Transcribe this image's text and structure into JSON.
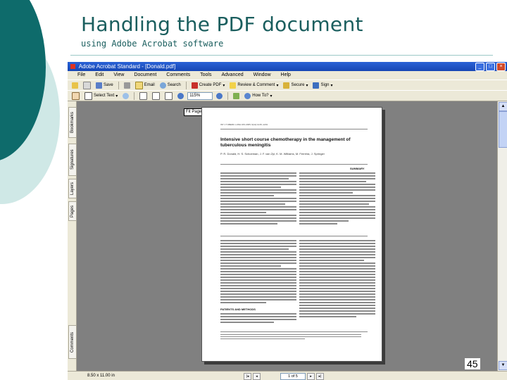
{
  "slide": {
    "title": "Handling the PDF document",
    "subtitle": "using Adobe Acrobat software",
    "page_number": "45"
  },
  "window": {
    "title": "Adobe Acrobat Standard - [Donald.pdf]",
    "buttons": {
      "minimize": "_",
      "maximize": "□",
      "close": "×"
    }
  },
  "menu": [
    "File",
    "Edit",
    "View",
    "Document",
    "Comments",
    "Tools",
    "Advanced",
    "Window",
    "Help"
  ],
  "toolbar1": {
    "save": "Save",
    "email": "Email",
    "search": "Search",
    "create_pdf": "Create PDF",
    "review_comment": "Review & Comment",
    "secure": "Secure",
    "sign": "Sign"
  },
  "toolbar2": {
    "select_text": "Select Text",
    "zoom": "115%",
    "how_to": "How To?"
  },
  "side_tabs": [
    "Bookmarks",
    "Signatures",
    "Layers",
    "Pages",
    "Comments"
  ],
  "document": {
    "hint": "Fit Page",
    "journal": "INT J TUBERC LUNG DIS 2005; 9(11):1215–1219",
    "article_title": "Intensive short course chemotherapy in the management of tuberculous meningitis",
    "authors": "P. R. Donald, H. S. Schoeman, J. F. van Zyl, K. M. Williams, M. Ferreira, J. Springer",
    "section_abstract": "SUMMARY",
    "section_patients": "PATIENTS AND METHODS"
  },
  "status": {
    "size": "8.50 x 11.00 in",
    "page": "1 of 5"
  },
  "colors": {
    "accent": "#1a5e5e",
    "deco_dark": "#0e6b6b",
    "deco_light": "#cfe8e6",
    "titlebar": "#2a62d6"
  }
}
